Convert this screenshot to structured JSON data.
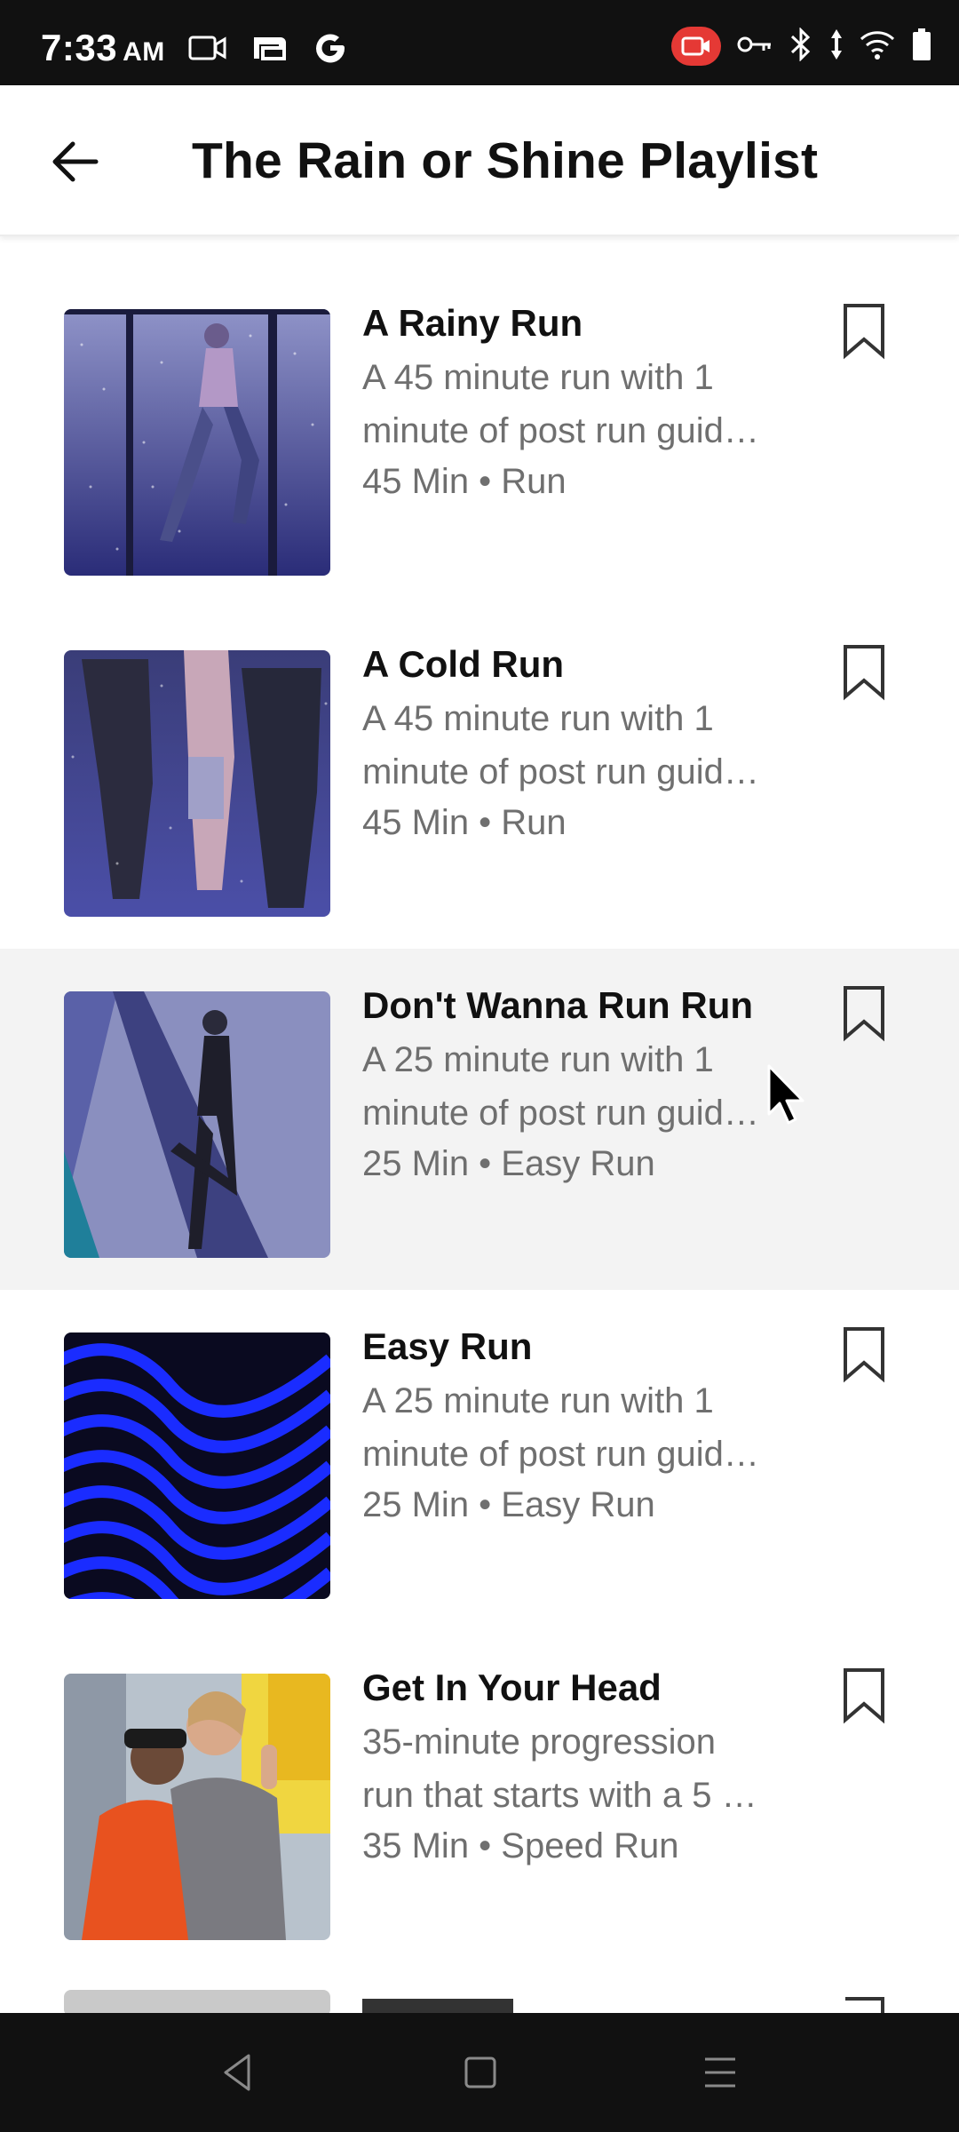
{
  "status_bar": {
    "time": "7:33",
    "ampm": "AM",
    "left_icons": [
      "video-icon",
      "cast-icon",
      "google-icon"
    ],
    "right_icons": [
      "screen-record-icon",
      "key-icon",
      "bluetooth-icon",
      "data-arrows-icon",
      "wifi-icon",
      "battery-icon"
    ]
  },
  "header": {
    "back_icon": "arrow-left-icon",
    "title": "The Rain or Shine Playlist"
  },
  "runs": [
    {
      "title": "A Rainy Run",
      "desc_line1": "A 45 minute run with 1",
      "desc_line2": "minute of post run guid…",
      "meta": "45 Min • Run"
    },
    {
      "title": "A Cold Run",
      "desc_line1": "A 45 minute run with 1",
      "desc_line2": "minute of post run guid…",
      "meta": "45 Min • Run"
    },
    {
      "title": "Don't Wanna Run Run",
      "desc_line1": "A 25 minute run with 1",
      "desc_line2": "minute of post run guid…",
      "meta": "25 Min • Easy Run"
    },
    {
      "title": "Easy Run",
      "desc_line1": "A 25 minute run with 1",
      "desc_line2": "minute of post run guid…",
      "meta": "25 Min • Easy Run"
    },
    {
      "title": "Get In Your Head",
      "desc_line1": "35-minute progression",
      "desc_line2": "run that starts with a 5 …",
      "meta": "35 Min • Speed Run"
    }
  ],
  "colors": {
    "status_bar_bg": "#111111",
    "highlight_row": "#f3f3f3",
    "secondary_text": "#6f6f6f",
    "record_badge": "#e53935",
    "easy_run_blue": "#1a2cff"
  },
  "nav_bar_icons": [
    "back-triangle-icon",
    "home-square-icon",
    "menu-lines-icon"
  ]
}
